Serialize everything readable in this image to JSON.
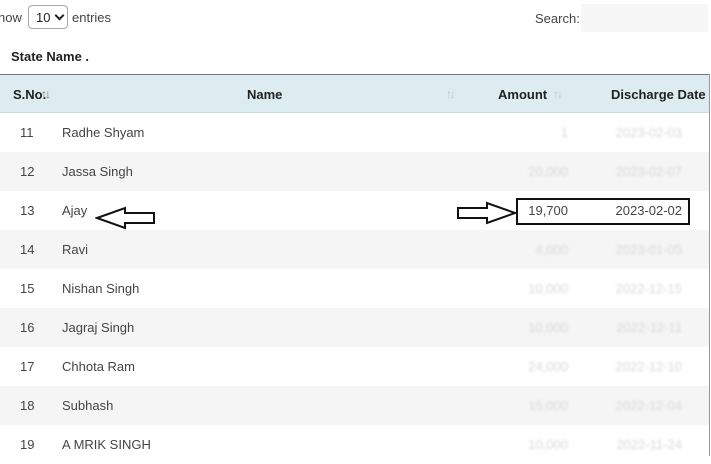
{
  "controls": {
    "show_label": "how",
    "page_size": "10",
    "entries_label": "entries",
    "search_label": "Search:",
    "search_value": ""
  },
  "state_name_label": "State Name .",
  "table": {
    "columns": [
      "S.No.",
      "Name",
      "Amount",
      "Discharge Date"
    ],
    "rows": [
      {
        "sno": "11",
        "name": "Radhe Shyam",
        "amount": "1",
        "date": "2023-02-03"
      },
      {
        "sno": "12",
        "name": "Jassa Singh",
        "amount": "20,000",
        "date": "2023-02-07"
      },
      {
        "sno": "13",
        "name": "Ajay",
        "amount": "19,700",
        "date": "2023-02-02"
      },
      {
        "sno": "14",
        "name": "Ravi",
        "amount": "4,000",
        "date": "2023-01-05"
      },
      {
        "sno": "15",
        "name": "Nishan Singh",
        "amount": "10,000",
        "date": "2022-12-15"
      },
      {
        "sno": "16",
        "name": "Jagraj Singh",
        "amount": "10,000",
        "date": "2022-12-11"
      },
      {
        "sno": "17",
        "name": "Chhota Ram",
        "amount": "24,000",
        "date": "2022-12-10"
      },
      {
        "sno": "18",
        "name": "Subhash",
        "amount": "15,000",
        "date": "2022-12-04"
      },
      {
        "sno": "19",
        "name": "A MRIK SINGH",
        "amount": "10,000",
        "date": "2022-11-24"
      }
    ]
  },
  "icons": {
    "sort": "sort-icon",
    "dropdown": "chevron-down-icon",
    "left_arrow": "arrow-left-icon",
    "right_arrow": "arrow-right-icon"
  },
  "highlighted_row": "13"
}
